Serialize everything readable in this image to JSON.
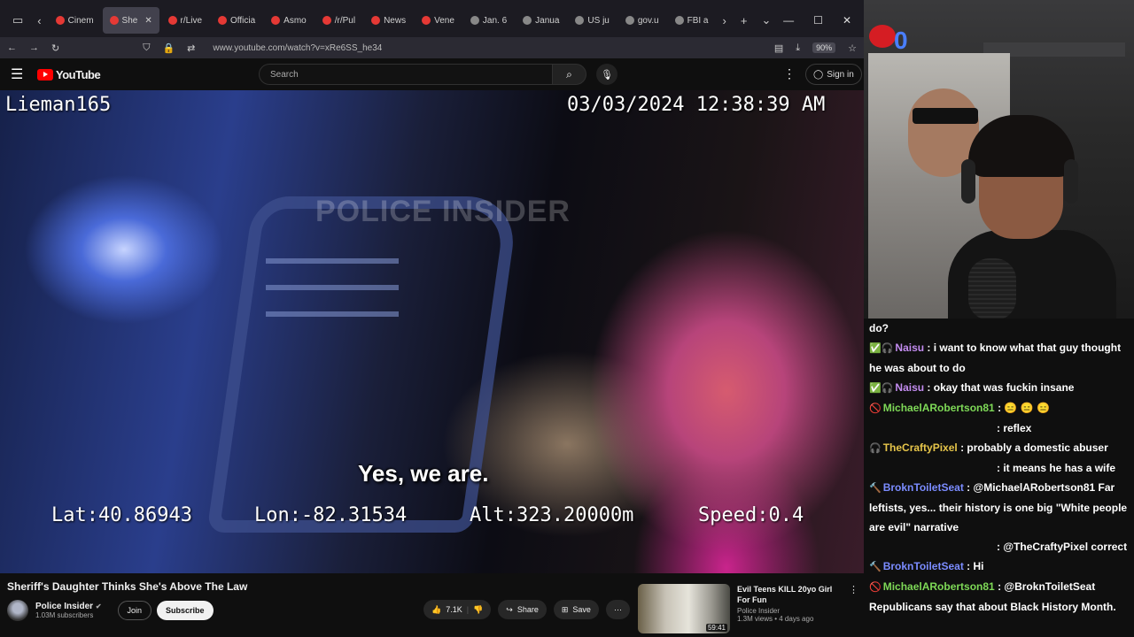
{
  "browser": {
    "tabs": [
      {
        "label": "Cinem",
        "active": false
      },
      {
        "label": "She",
        "active": true
      },
      {
        "label": "r/Live",
        "active": false
      },
      {
        "label": "Officia",
        "active": false
      },
      {
        "label": "Asmo",
        "active": false
      },
      {
        "label": "/r/Pul",
        "active": false
      },
      {
        "label": "News",
        "active": false
      },
      {
        "label": "Vene",
        "active": false
      },
      {
        "label": "Jan. 6",
        "active": false
      },
      {
        "label": "Janua",
        "active": false
      },
      {
        "label": "US ju",
        "active": false
      },
      {
        "label": "gov.u",
        "active": false
      },
      {
        "label": "FBI a",
        "active": false
      }
    ],
    "url": "www.youtube.com/watch?v=xRe6SS_he34",
    "zoom": "90%",
    "signin": "Sign in"
  },
  "youtube": {
    "logo_text": "YouTube",
    "search_placeholder": "Search",
    "signin": "Sign in"
  },
  "video": {
    "osd_user": "Lieman165",
    "osd_datetime": "03/03/2024  12:38:39 AM",
    "watermark": "POLICE INSIDER",
    "caption": "Yes, we are.",
    "lat": "Lat:40.86943",
    "lon": "Lon:-82.31534",
    "alt": "Alt:323.20000m",
    "speed": "Speed:0.4"
  },
  "watch": {
    "title": "Sheriff's Daughter Thinks She's Above The Law",
    "channel": "Police Insider",
    "subscribers": "1.03M subscribers",
    "join": "Join",
    "subscribe": "Subscribe",
    "likes": "7.1K",
    "share": "Share",
    "save": "Save"
  },
  "recommended": {
    "title": "Evil Teens KILL 20yo Girl For Fun",
    "channel": "Police Insider",
    "meta": "1.3M views • 4 days ago",
    "duration": "59:41"
  },
  "chat": [
    {
      "icons": "",
      "name": "",
      "name_color": "#ffffff",
      "text": "do?",
      "indent": false
    },
    {
      "icons": "✅🎧",
      "name": "Naisu",
      "name_color": "#c38cf0",
      "text": " : i want to know what that guy thought he was about to do",
      "indent": false
    },
    {
      "icons": "✅🎧",
      "name": "Naisu",
      "name_color": "#c38cf0",
      "text": " : okay that was fuckin insane",
      "indent": false
    },
    {
      "icons": "🚫",
      "name": "MichaelARobertson81",
      "name_color": "#7ed957",
      "text": " : 😑 😑 😑",
      "indent": false
    },
    {
      "icons": "",
      "name": "",
      "name_color": "#ffffff",
      "text": ": reflex",
      "indent": true
    },
    {
      "icons": "🎧",
      "name": "TheCraftyPixel",
      "name_color": "#e6c54a",
      "text": " : probably a domestic abuser",
      "indent": false
    },
    {
      "icons": "",
      "name": "",
      "name_color": "#ffffff",
      "text": ": it means he has a wife",
      "indent": true
    },
    {
      "icons": "🔨",
      "name": "BroknToiletSeat",
      "name_color": "#7b8cff",
      "text": " : @MichaelARobertson81 Far leftists, yes... their history is one big \"White people are evil\" narrative",
      "indent": false
    },
    {
      "icons": "",
      "name": "",
      "name_color": "#ffffff",
      "text": ": @TheCraftyPixel correct",
      "indent": true
    },
    {
      "icons": "🔨",
      "name": "BroknToiletSeat",
      "name_color": "#7b8cff",
      "text": " : Hi",
      "indent": false
    },
    {
      "icons": "🚫",
      "name": "MichaelARobertson81",
      "name_color": "#7ed957",
      "text": " : @BroknToiletSeat Republicans say that about Black History Month.",
      "indent": false
    }
  ]
}
